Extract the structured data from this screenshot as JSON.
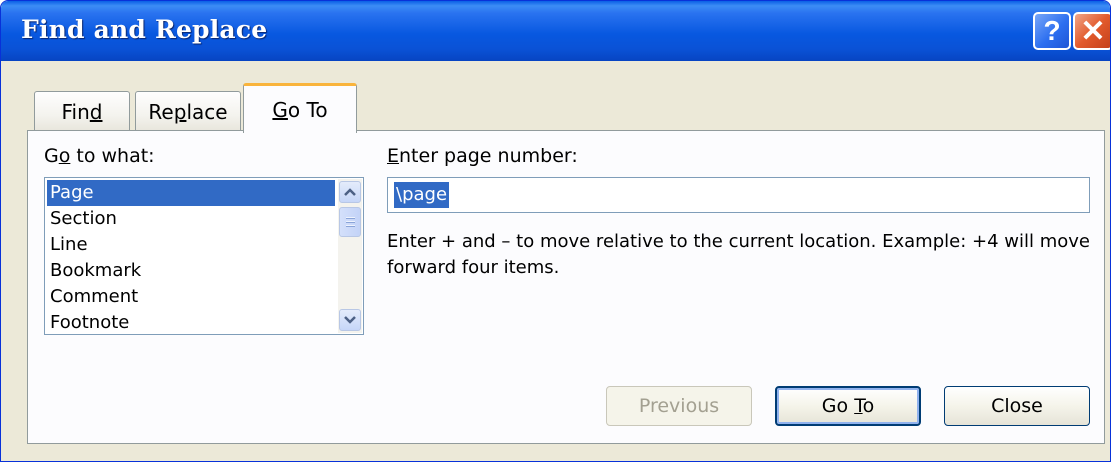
{
  "window": {
    "title": "Find and Replace",
    "help_symbol": "?",
    "close_symbol": "✕"
  },
  "tabs": [
    {
      "pre": "Fin",
      "key": "d",
      "post": ""
    },
    {
      "pre": "Re",
      "key": "p",
      "post": "lace"
    },
    {
      "pre": "",
      "key": "G",
      "post": "o To"
    }
  ],
  "go_to_what": {
    "label_pre": "G",
    "label_key": "o",
    "label_post": " to what:",
    "items": [
      "Page",
      "Section",
      "Line",
      "Bookmark",
      "Comment",
      "Footnote"
    ],
    "selected": "Page"
  },
  "page_number": {
    "label_pre": "",
    "label_key": "E",
    "label_post": "nter page number:",
    "value": "\\page"
  },
  "hint_text": "Enter + and – to move relative to the current location. Example: +4 will move forward four items.",
  "buttons": {
    "previous": "Previous",
    "goto_pre": "Go ",
    "goto_key": "T",
    "goto_post": "o",
    "close": "Close"
  },
  "colors": {
    "titlebar": "#0858e0",
    "selection": "#316ac5",
    "active_tab_accent": "#f9b43c",
    "dialog_bg": "#ece9d8"
  }
}
